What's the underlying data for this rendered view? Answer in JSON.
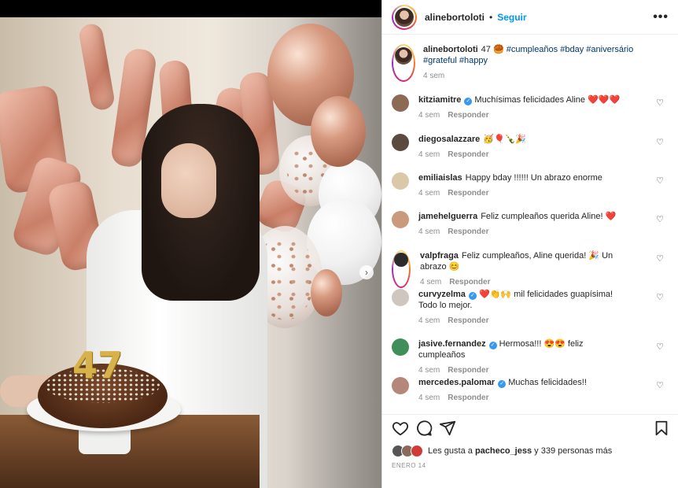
{
  "post": {
    "author": "alinebortoloti",
    "follow_label": "Seguir",
    "separator": "•",
    "more_label": "•••",
    "caption_text": "47 🥮",
    "hashtags": [
      "#cumpleaños",
      "#bday",
      "#aniversário",
      "#grateful",
      "#happy"
    ],
    "caption_time": "4 sem",
    "candle_digits": "47",
    "carousel_dots": 3,
    "active_dot": 0
  },
  "comments": [
    {
      "user": "kitziamitre",
      "verified": true,
      "text": "Muchísimas felicidades Aline ❤️❤️❤️",
      "time": "4 sem",
      "reply": "Responder",
      "avatar_color": "#8b6b55"
    },
    {
      "user": "diegosalazzare",
      "verified": false,
      "text": "🥳🎈🍾🎉",
      "time": "4 sem",
      "reply": "Responder",
      "avatar_color": "#5a4a3f"
    },
    {
      "user": "emiliaislas",
      "verified": false,
      "text": "Happy bday !!!!!! Un abrazo enorme",
      "time": "4 sem",
      "reply": "Responder",
      "avatar_color": "#d9c9a8"
    },
    {
      "user": "jamehelguerra",
      "verified": false,
      "text": "Feliz cumpleaños querida Aline! ❤️",
      "time": "4 sem",
      "reply": "Responder",
      "avatar_color": "#c99a7c"
    },
    {
      "user": "valpfraga",
      "verified": false,
      "text": "Feliz cumpleaños, Aline querida! 🎉 Un abrazo 😊",
      "time": "4 sem",
      "reply": "Responder",
      "avatar_color": "#2b2b2b"
    },
    {
      "user": "curvyzelma",
      "verified": true,
      "text": "❤️👏🙌 mil felicidades guapísima! Todo lo mejor.",
      "time": "4 sem",
      "reply": "Responder",
      "avatar_color": "#cfc7bf"
    },
    {
      "user": "jasive.fernandez",
      "verified": true,
      "text": "Hermosa!!! 😍😍 feliz cumpleaños",
      "time": "4 sem",
      "reply": "Responder",
      "avatar_color": "#3f8f5a"
    },
    {
      "user": "mercedes.palomar",
      "verified": true,
      "text": "Muchas felicidades!!",
      "time": "4 sem",
      "reply": "Responder",
      "avatar_color": "#b5867a"
    }
  ],
  "likes": {
    "prefix": "Les gusta a",
    "user": "pacheco_jess",
    "suffix": "y 339 personas más"
  },
  "date": "ENERO 14",
  "icons": [
    "heart-icon",
    "comment-icon",
    "share-icon",
    "save-icon",
    "chevron-right-icon",
    "user-tag-icon",
    "more-icon"
  ]
}
